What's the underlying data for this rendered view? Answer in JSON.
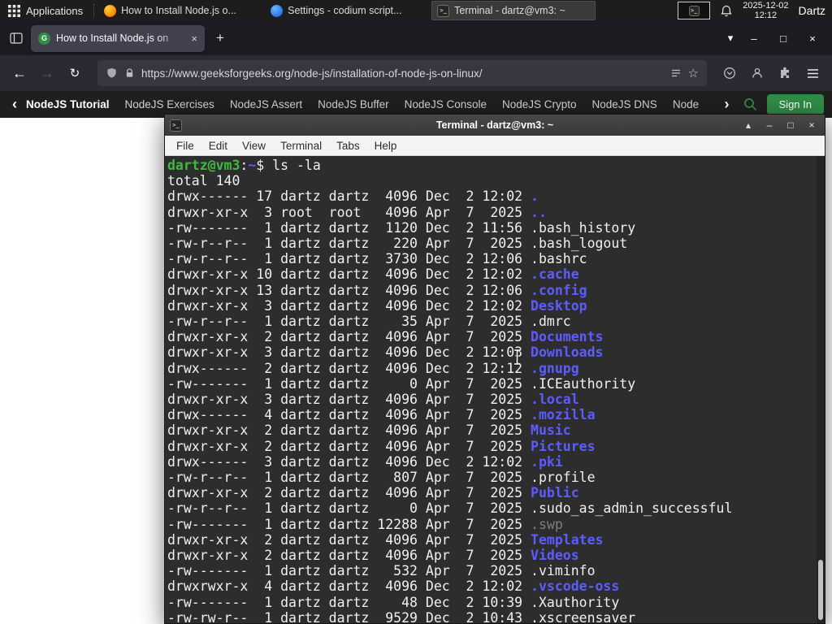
{
  "colors": {
    "dir_blue": "#5c5cff",
    "prompt_green": "#40b940",
    "dim_gray": "#7f7f7f",
    "gfg_green": "#2f8d46"
  },
  "glyphs": {
    "shade": "▴",
    "minimize": "–",
    "maximize": "□",
    "close": "×",
    "back": "←",
    "forward": "→",
    "reload": "↻",
    "new_tab": "+",
    "tabs_chevron": "▾",
    "tab_close": "×",
    "star": "☆",
    "chevron_left": "‹",
    "chevron_right": "›",
    "favicon_letter": "G",
    "terminal_glyph": ">_"
  },
  "panel": {
    "applications_label": "Applications",
    "taskbar": [
      {
        "label": "How to Install Node.js o...",
        "app": "firefox"
      },
      {
        "label": "Settings - codium script...",
        "app": "codium"
      },
      {
        "label": "Terminal - dartz@vm3: ~",
        "app": "terminal",
        "active": true
      }
    ],
    "clock": {
      "date": "2025-12-02",
      "time": "12:12"
    },
    "user": "Dartz"
  },
  "browser": {
    "tab_title": "How to Install Node.js on",
    "url": "https://www.geeksforgeeks.org/node-js/installation-of-node-js-on-linux/",
    "nav_links": [
      "NodeJS Tutorial",
      "NodeJS Exercises",
      "NodeJS Assert",
      "NodeJS Buffer",
      "NodeJS Console",
      "NodeJS Crypto",
      "NodeJS DNS",
      "Node"
    ],
    "active_link_index": 0,
    "sign_in_label": "Sign In"
  },
  "terminal": {
    "title": "Terminal - dartz@vm3: ~",
    "menu": [
      "File",
      "Edit",
      "View",
      "Terminal",
      "Tabs",
      "Help"
    ],
    "prompt": {
      "user_host": "dartz@vm3",
      "colon": ":",
      "path": "~",
      "symbol": "$ ",
      "command": "ls -la"
    },
    "total_line": "total 140",
    "listing": [
      {
        "perms": "drwx------",
        "links": "17",
        "owner": "dartz",
        "group": "dartz",
        "size": "4096",
        "month": "Dec",
        "day": "2",
        "time": "12:02",
        "name": ".",
        "type": "dir"
      },
      {
        "perms": "drwxr-xr-x",
        "links": "3",
        "owner": "root",
        "group": "root",
        "size": "4096",
        "month": "Apr",
        "day": "7",
        "time": "2025",
        "name": "..",
        "type": "dir"
      },
      {
        "perms": "-rw-------",
        "links": "1",
        "owner": "dartz",
        "group": "dartz",
        "size": "1120",
        "month": "Dec",
        "day": "2",
        "time": "11:56",
        "name": ".bash_history",
        "type": "file"
      },
      {
        "perms": "-rw-r--r--",
        "links": "1",
        "owner": "dartz",
        "group": "dartz",
        "size": "220",
        "month": "Apr",
        "day": "7",
        "time": "2025",
        "name": ".bash_logout",
        "type": "file"
      },
      {
        "perms": "-rw-r--r--",
        "links": "1",
        "owner": "dartz",
        "group": "dartz",
        "size": "3730",
        "month": "Dec",
        "day": "2",
        "time": "12:06",
        "name": ".bashrc",
        "type": "file"
      },
      {
        "perms": "drwxr-xr-x",
        "links": "10",
        "owner": "dartz",
        "group": "dartz",
        "size": "4096",
        "month": "Dec",
        "day": "2",
        "time": "12:02",
        "name": ".cache",
        "type": "dir"
      },
      {
        "perms": "drwxr-xr-x",
        "links": "13",
        "owner": "dartz",
        "group": "dartz",
        "size": "4096",
        "month": "Dec",
        "day": "2",
        "time": "12:06",
        "name": ".config",
        "type": "dir"
      },
      {
        "perms": "drwxr-xr-x",
        "links": "3",
        "owner": "dartz",
        "group": "dartz",
        "size": "4096",
        "month": "Dec",
        "day": "2",
        "time": "12:02",
        "name": "Desktop",
        "type": "dir"
      },
      {
        "perms": "-rw-r--r--",
        "links": "1",
        "owner": "dartz",
        "group": "dartz",
        "size": "35",
        "month": "Apr",
        "day": "7",
        "time": "2025",
        "name": ".dmrc",
        "type": "file"
      },
      {
        "perms": "drwxr-xr-x",
        "links": "2",
        "owner": "dartz",
        "group": "dartz",
        "size": "4096",
        "month": "Apr",
        "day": "7",
        "time": "2025",
        "name": "Documents",
        "type": "dir"
      },
      {
        "perms": "drwxr-xr-x",
        "links": "3",
        "owner": "dartz",
        "group": "dartz",
        "size": "4096",
        "month": "Dec",
        "day": "2",
        "time": "12:03",
        "name": "Downloads",
        "type": "dir"
      },
      {
        "perms": "drwx------",
        "links": "2",
        "owner": "dartz",
        "group": "dartz",
        "size": "4096",
        "month": "Dec",
        "day": "2",
        "time": "12:12",
        "name": ".gnupg",
        "type": "dir"
      },
      {
        "perms": "-rw-------",
        "links": "1",
        "owner": "dartz",
        "group": "dartz",
        "size": "0",
        "month": "Apr",
        "day": "7",
        "time": "2025",
        "name": ".ICEauthority",
        "type": "file"
      },
      {
        "perms": "drwxr-xr-x",
        "links": "3",
        "owner": "dartz",
        "group": "dartz",
        "size": "4096",
        "month": "Apr",
        "day": "7",
        "time": "2025",
        "name": ".local",
        "type": "dir"
      },
      {
        "perms": "drwx------",
        "links": "4",
        "owner": "dartz",
        "group": "dartz",
        "size": "4096",
        "month": "Apr",
        "day": "7",
        "time": "2025",
        "name": ".mozilla",
        "type": "dir"
      },
      {
        "perms": "drwxr-xr-x",
        "links": "2",
        "owner": "dartz",
        "group": "dartz",
        "size": "4096",
        "month": "Apr",
        "day": "7",
        "time": "2025",
        "name": "Music",
        "type": "dir"
      },
      {
        "perms": "drwxr-xr-x",
        "links": "2",
        "owner": "dartz",
        "group": "dartz",
        "size": "4096",
        "month": "Apr",
        "day": "7",
        "time": "2025",
        "name": "Pictures",
        "type": "dir"
      },
      {
        "perms": "drwx------",
        "links": "3",
        "owner": "dartz",
        "group": "dartz",
        "size": "4096",
        "month": "Dec",
        "day": "2",
        "time": "12:02",
        "name": ".pki",
        "type": "dir"
      },
      {
        "perms": "-rw-r--r--",
        "links": "1",
        "owner": "dartz",
        "group": "dartz",
        "size": "807",
        "month": "Apr",
        "day": "7",
        "time": "2025",
        "name": ".profile",
        "type": "file"
      },
      {
        "perms": "drwxr-xr-x",
        "links": "2",
        "owner": "dartz",
        "group": "dartz",
        "size": "4096",
        "month": "Apr",
        "day": "7",
        "time": "2025",
        "name": "Public",
        "type": "dir"
      },
      {
        "perms": "-rw-r--r--",
        "links": "1",
        "owner": "dartz",
        "group": "dartz",
        "size": "0",
        "month": "Apr",
        "day": "7",
        "time": "2025",
        "name": ".sudo_as_admin_successful",
        "type": "file"
      },
      {
        "perms": "-rw-------",
        "links": "1",
        "owner": "dartz",
        "group": "dartz",
        "size": "12288",
        "month": "Apr",
        "day": "7",
        "time": "2025",
        "name": ".swp",
        "type": "dim"
      },
      {
        "perms": "drwxr-xr-x",
        "links": "2",
        "owner": "dartz",
        "group": "dartz",
        "size": "4096",
        "month": "Apr",
        "day": "7",
        "time": "2025",
        "name": "Templates",
        "type": "dir"
      },
      {
        "perms": "drwxr-xr-x",
        "links": "2",
        "owner": "dartz",
        "group": "dartz",
        "size": "4096",
        "month": "Apr",
        "day": "7",
        "time": "2025",
        "name": "Videos",
        "type": "dir"
      },
      {
        "perms": "-rw-------",
        "links": "1",
        "owner": "dartz",
        "group": "dartz",
        "size": "532",
        "month": "Apr",
        "day": "7",
        "time": "2025",
        "name": ".viminfo",
        "type": "file"
      },
      {
        "perms": "drwxrwxr-x",
        "links": "4",
        "owner": "dartz",
        "group": "dartz",
        "size": "4096",
        "month": "Dec",
        "day": "2",
        "time": "12:02",
        "name": ".vscode-oss",
        "type": "dir"
      },
      {
        "perms": "-rw-------",
        "links": "1",
        "owner": "dartz",
        "group": "dartz",
        "size": "48",
        "month": "Dec",
        "day": "2",
        "time": "10:39",
        "name": ".Xauthority",
        "type": "file"
      },
      {
        "perms": "-rw-rw-r--",
        "links": "1",
        "owner": "dartz",
        "group": "dartz",
        "size": "9529",
        "month": "Dec",
        "day": "2",
        "time": "10:43",
        "name": ".xscreensaver",
        "type": "file"
      }
    ]
  }
}
